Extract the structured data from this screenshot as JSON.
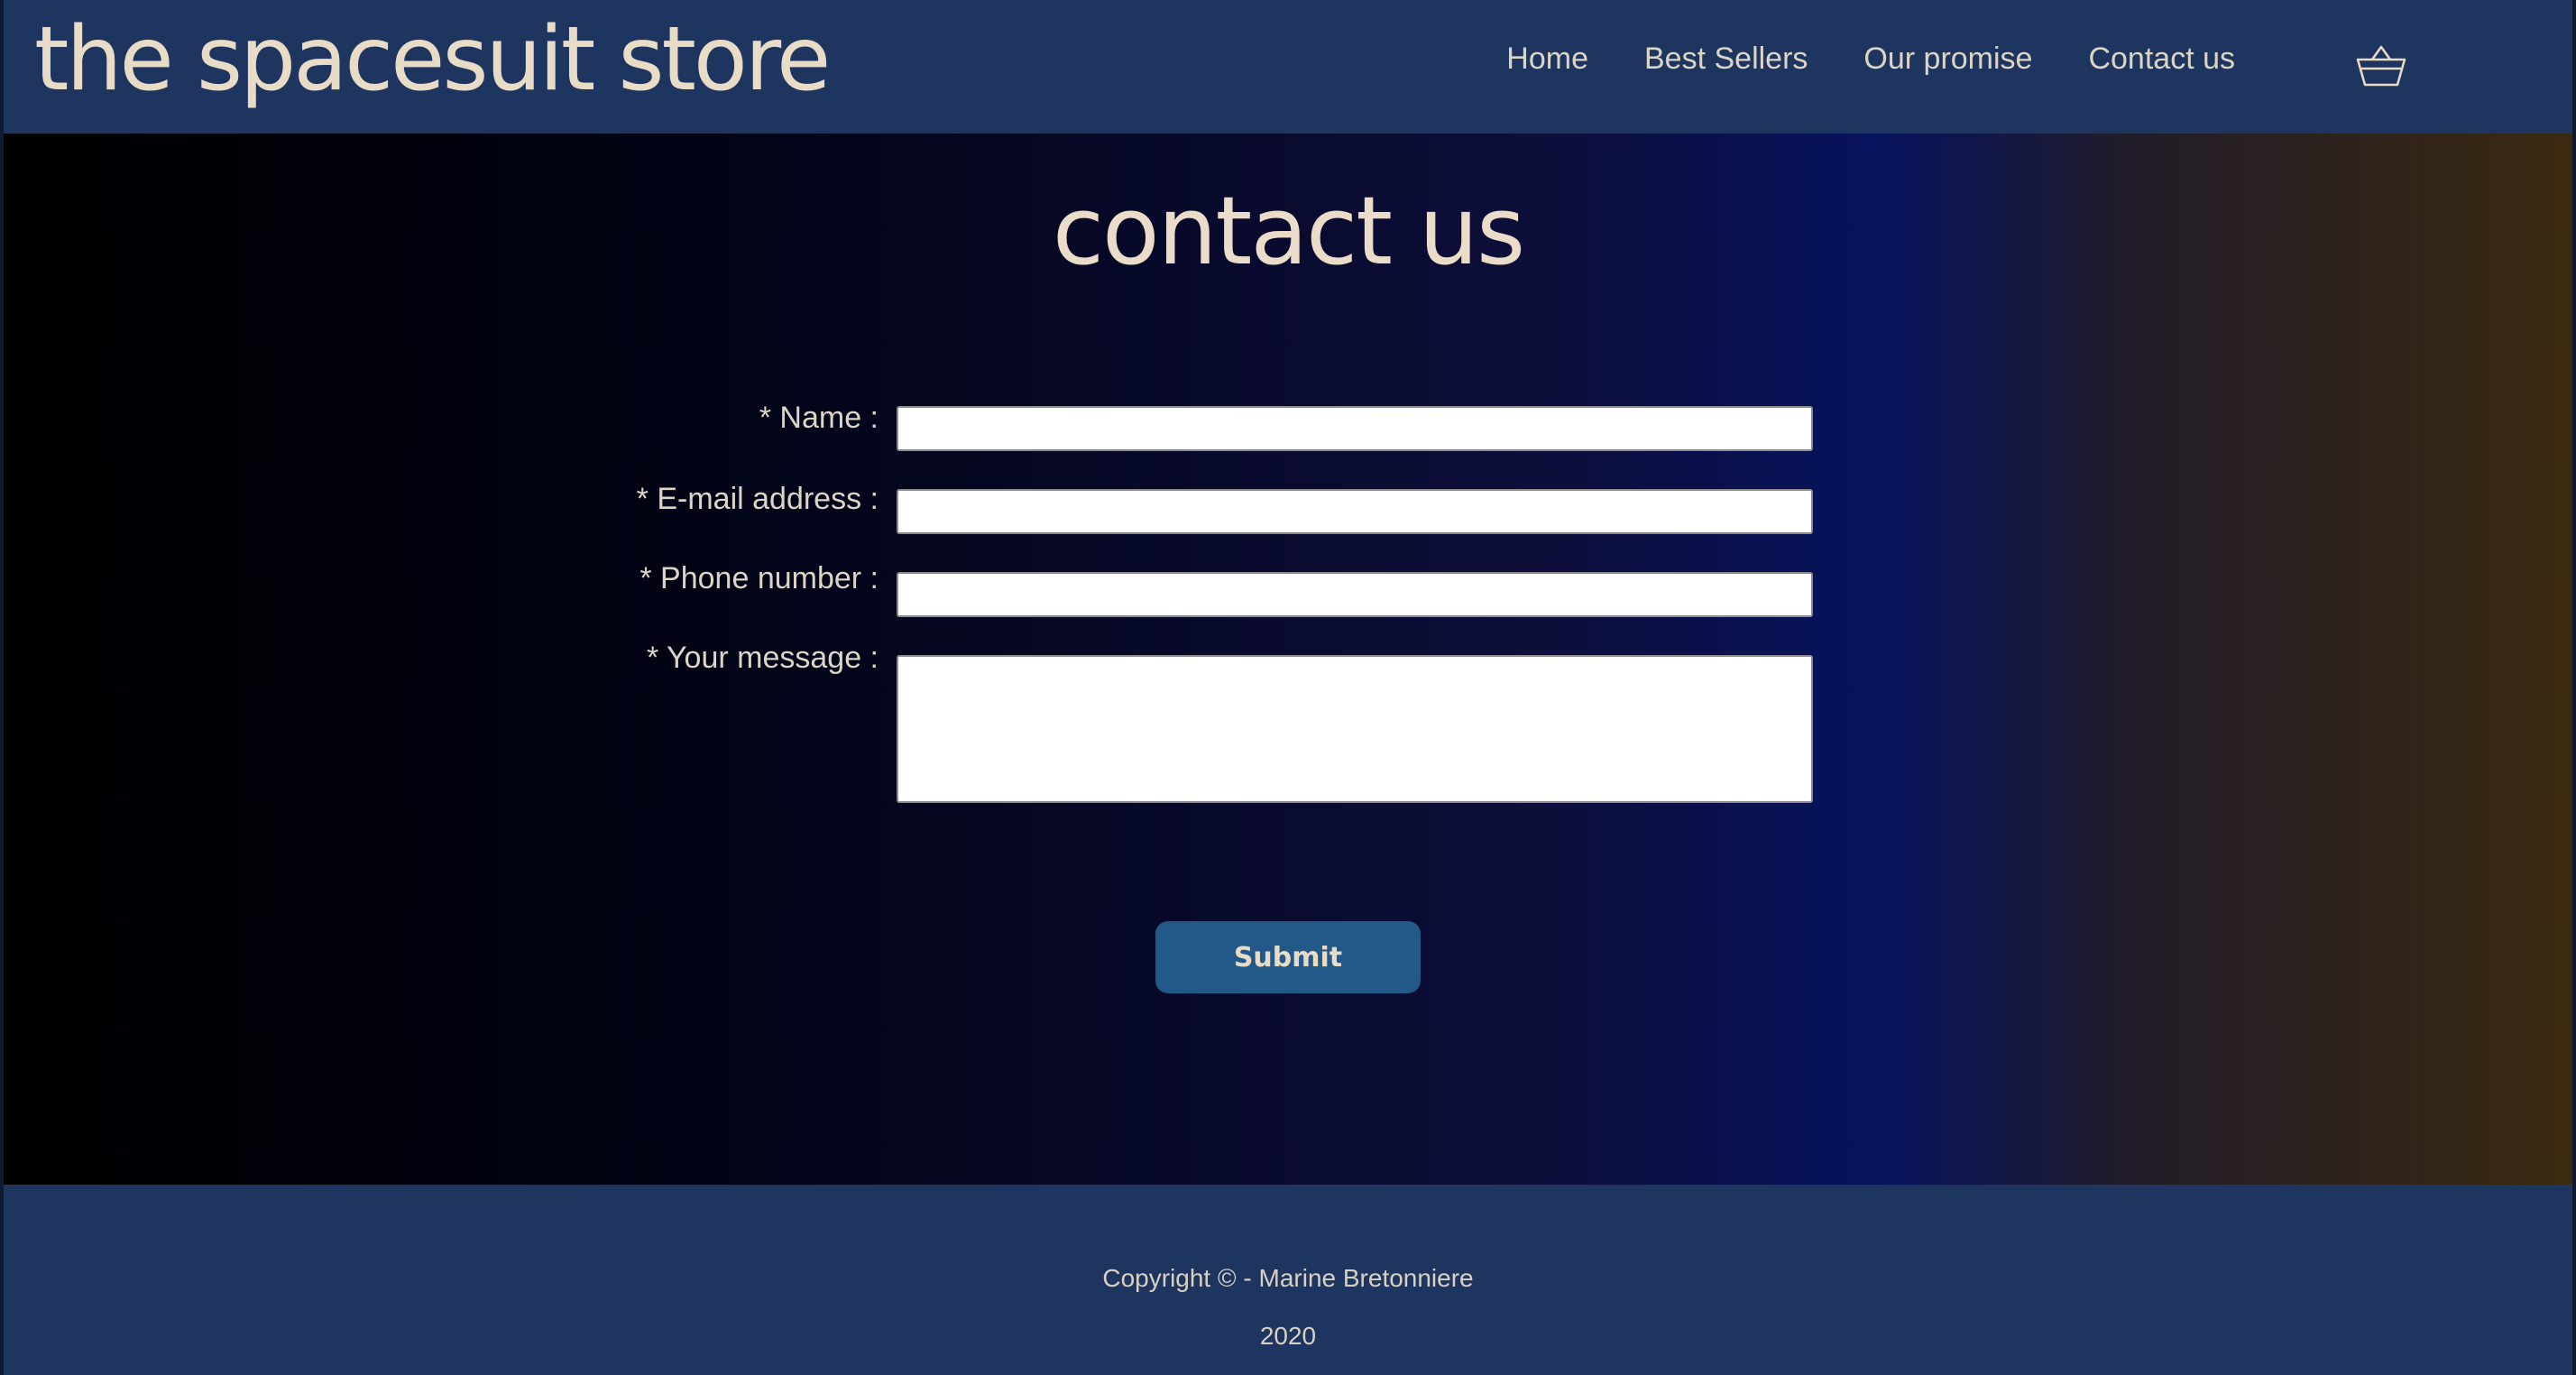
{
  "header": {
    "brand": "the spacesuit store",
    "nav": {
      "home": "Home",
      "best_sellers": "Best Sellers",
      "our_promise": "Our promise",
      "contact_us": "Contact us"
    },
    "cart_icon": "basket-icon"
  },
  "main": {
    "title": "contact us",
    "form": {
      "name_label": "* Name :",
      "name_value": "",
      "email_label": "* E-mail address :",
      "email_value": "",
      "phone_label": "* Phone number :",
      "phone_value": "",
      "message_label": "* Your message :",
      "message_value": "",
      "submit_label": "Submit"
    }
  },
  "footer": {
    "copyright": "Copyright © - Marine Bretonniere",
    "year": "2020"
  },
  "colors": {
    "header_bg": "#1e355f",
    "text": "#e6dccb",
    "button_bg": "#235989"
  }
}
